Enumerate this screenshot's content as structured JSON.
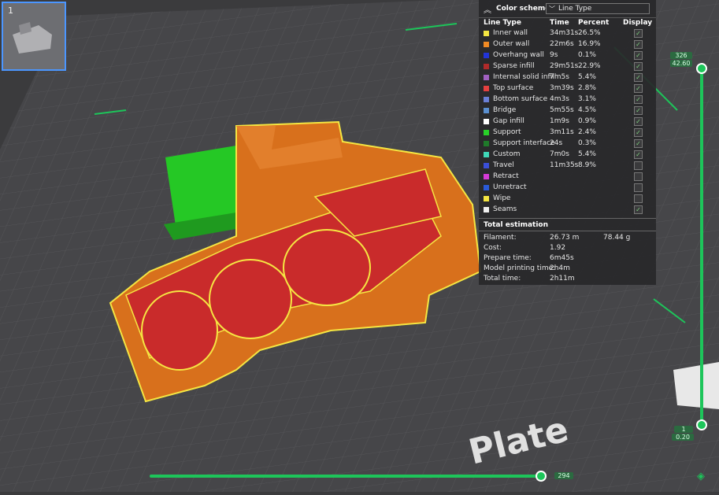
{
  "thumbnail": {
    "plate_number": "1"
  },
  "legend": {
    "title": "Color scheme",
    "scheme_value": "Line Type",
    "columns": {
      "type": "Line Type",
      "time": "Time",
      "percent": "Percent",
      "display": "Display"
    },
    "rows": [
      {
        "label": "Inner wall",
        "time": "34m31s",
        "percent": "26.5%",
        "color": "#f5e642",
        "checked": true
      },
      {
        "label": "Outer wall",
        "time": "22m6s",
        "percent": "16.9%",
        "color": "#f08a24",
        "checked": true
      },
      {
        "label": "Overhang wall",
        "time": "9s",
        "percent": "0.1%",
        "color": "#2234d8",
        "checked": true
      },
      {
        "label": "Sparse infill",
        "time": "29m51s",
        "percent": "22.9%",
        "color": "#b02a2a",
        "checked": true
      },
      {
        "label": "Internal solid infill",
        "time": "7m5s",
        "percent": "5.4%",
        "color": "#a060c0",
        "checked": true
      },
      {
        "label": "Top surface",
        "time": "3m39s",
        "percent": "2.8%",
        "color": "#e54040",
        "checked": true
      },
      {
        "label": "Bottom surface",
        "time": "4m3s",
        "percent": "3.1%",
        "color": "#6a7fd6",
        "checked": true
      },
      {
        "label": "Bridge",
        "time": "5m55s",
        "percent": "4.5%",
        "color": "#5a8fd0",
        "checked": true
      },
      {
        "label": "Gap infill",
        "time": "1m9s",
        "percent": "0.9%",
        "color": "#ffffff",
        "checked": true
      },
      {
        "label": "Support",
        "time": "3m11s",
        "percent": "2.4%",
        "color": "#28d028",
        "checked": true
      },
      {
        "label": "Support interface",
        "time": "24s",
        "percent": "0.3%",
        "color": "#1f7a2a",
        "checked": true
      },
      {
        "label": "Custom",
        "time": "7m0s",
        "percent": "5.4%",
        "color": "#3fd8b8",
        "checked": true
      },
      {
        "label": "Travel",
        "time": "11m35s",
        "percent": "8.9%",
        "color": "#3a4fd8",
        "checked": false
      },
      {
        "label": "Retract",
        "time": "",
        "percent": "",
        "color": "#d63ad6",
        "checked": false
      },
      {
        "label": "Unretract",
        "time": "",
        "percent": "",
        "color": "#2a5ad8",
        "checked": false
      },
      {
        "label": "Wipe",
        "time": "",
        "percent": "",
        "color": "#f5e642",
        "checked": false
      },
      {
        "label": "Seams",
        "time": "",
        "percent": "",
        "color": "#f0f0f0",
        "checked": true
      }
    ],
    "total_title": "Total estimation",
    "totals": [
      {
        "label": "Filament:",
        "value": "26.73 m",
        "extra": "78.44 g"
      },
      {
        "label": "Cost:",
        "value": "1.92",
        "extra": ""
      },
      {
        "label": "Prepare time:",
        "value": "6m45s",
        "extra": ""
      },
      {
        "label": "Model printing time:",
        "value": "2h4m",
        "extra": ""
      },
      {
        "label": "Total time:",
        "value": "2h11m",
        "extra": ""
      }
    ]
  },
  "layer_slider": {
    "top_layer": "326",
    "top_height": "42.60",
    "bottom_layer": "1",
    "bottom_height": "0.20"
  },
  "move_slider": {
    "value": "294"
  },
  "plate_text": "Plate",
  "colors": {
    "accent": "#1dc55a",
    "model": "#d8701c",
    "infill": "#c92b2b",
    "support": "#25c825"
  }
}
